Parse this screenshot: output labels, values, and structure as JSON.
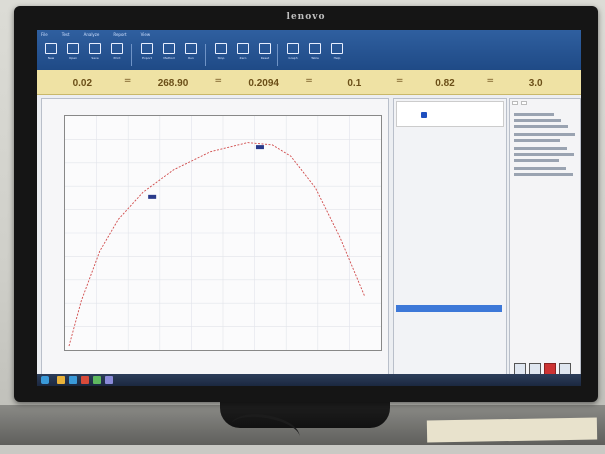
{
  "monitor": {
    "brand": "lenovo"
  },
  "ribbon": {
    "tabs": [
      "File",
      "Test",
      "Analyze",
      "Report",
      "View"
    ],
    "buttons": [
      "New",
      "Open",
      "Save",
      "Print",
      "Export",
      "Method",
      "Run",
      "Stop",
      "Zero",
      "Reset",
      "Graph",
      "Table",
      "Help"
    ]
  },
  "results": [
    {
      "label": "",
      "value": "0.02"
    },
    {
      "label": "",
      "value": "268.90"
    },
    {
      "label": "",
      "value": "0.2094"
    },
    {
      "label": "",
      "value": "0.1"
    },
    {
      "label": "",
      "value": "0.82"
    },
    {
      "label": "",
      "value": "3.0"
    }
  ],
  "plot": {
    "tab": "",
    "title": "",
    "xlabel": "",
    "ylabel": ""
  },
  "chart_data": {
    "type": "line",
    "title": "",
    "xlabel": "",
    "ylabel": "",
    "xlim": [
      0,
      1
    ],
    "ylim": [
      0,
      1
    ],
    "grid": true,
    "series": [
      {
        "name": "",
        "x": [
          0.0,
          0.04,
          0.1,
          0.16,
          0.24,
          0.34,
          0.46,
          0.58,
          0.66,
          0.72,
          0.8,
          0.88,
          0.96
        ],
        "y": [
          0.0,
          0.2,
          0.42,
          0.56,
          0.68,
          0.78,
          0.86,
          0.9,
          0.89,
          0.84,
          0.7,
          0.48,
          0.22
        ]
      }
    ],
    "markers": [
      {
        "x": 0.27,
        "y": 0.66
      },
      {
        "x": 0.62,
        "y": 0.88
      }
    ]
  },
  "properties": {
    "preview_label": "",
    "rows": [
      {
        "k": "",
        "v": ""
      },
      {
        "k": "",
        "v": ""
      },
      {
        "k": "",
        "v": ""
      },
      {
        "k": "",
        "v": ""
      },
      {
        "k": "",
        "v": ""
      },
      {
        "k": "",
        "v": ""
      },
      {
        "k": "",
        "v": ""
      },
      {
        "k": "",
        "v": ""
      },
      {
        "k": "",
        "v": ""
      },
      {
        "k": "",
        "v": ""
      },
      {
        "k": "",
        "v": ""
      },
      {
        "k": "",
        "v": ""
      },
      {
        "k": "",
        "v": ""
      },
      {
        "k": "",
        "v": ""
      },
      {
        "k": "",
        "v": ""
      },
      {
        "k": "",
        "v": ""
      },
      {
        "k": "",
        "v": ""
      },
      {
        "k": "",
        "v": ""
      },
      {
        "k": "",
        "v": ""
      },
      {
        "k": "",
        "v": ""
      },
      {
        "k": "",
        "v": ""
      },
      {
        "k": "",
        "v": ""
      },
      {
        "k": "",
        "v": ""
      },
      {
        "k": "",
        "v": ""
      },
      {
        "k": "",
        "v": ""
      },
      {
        "k": "",
        "v": ""
      },
      {
        "k": "",
        "v": ""
      },
      {
        "k": "",
        "v": ""
      },
      {
        "k": "",
        "v": ""
      },
      {
        "k": "",
        "v": ""
      }
    ],
    "selected_index": 22
  },
  "side": {
    "tabs": [
      "",
      ""
    ],
    "icons": [
      "grid-icon",
      "chart-icon",
      "flag-icon",
      "settings-icon"
    ]
  },
  "taskbar": {
    "apps": [
      {
        "color": "#e8b23a"
      },
      {
        "color": "#3a9ad9"
      },
      {
        "color": "#d94b3a"
      },
      {
        "color": "#5fb85f"
      },
      {
        "color": "#8a8ad9"
      }
    ],
    "clock": ""
  }
}
